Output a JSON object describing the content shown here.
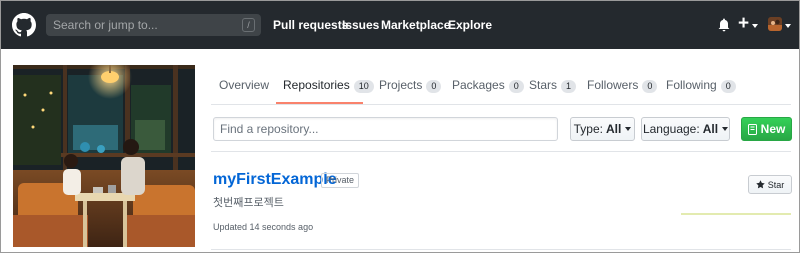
{
  "header": {
    "search_placeholder": "Search or jump to...",
    "search_key": "/",
    "nav": [
      "Pull requests",
      "Issues",
      "Marketplace",
      "Explore"
    ],
    "icons": [
      "github-logo",
      "bell-icon",
      "plus-icon",
      "avatar"
    ]
  },
  "tabs": [
    {
      "label": "Overview",
      "count": ""
    },
    {
      "label": "Repositories",
      "count": "10",
      "active": true
    },
    {
      "label": "Projects",
      "count": "0"
    },
    {
      "label": "Packages",
      "count": "0"
    },
    {
      "label": "Stars",
      "count": "1"
    },
    {
      "label": "Followers",
      "count": "0"
    },
    {
      "label": "Following",
      "count": "0"
    }
  ],
  "filters": {
    "search_placeholder": "Find a repository...",
    "type_label": "Type:",
    "type_value": "All",
    "language_label": "Language:",
    "language_value": "All",
    "new_label": "New"
  },
  "repos": [
    {
      "name": "myFirstExample",
      "visibility": "Private",
      "description": "첫번째프로젝트",
      "updated": "Updated 14 seconds ago",
      "star_label": "Star"
    }
  ],
  "colors": {
    "header_bg": "#24292e",
    "link": "#0366d6",
    "active_tab_underline": "#f9826c",
    "new_button": "#28a745"
  }
}
